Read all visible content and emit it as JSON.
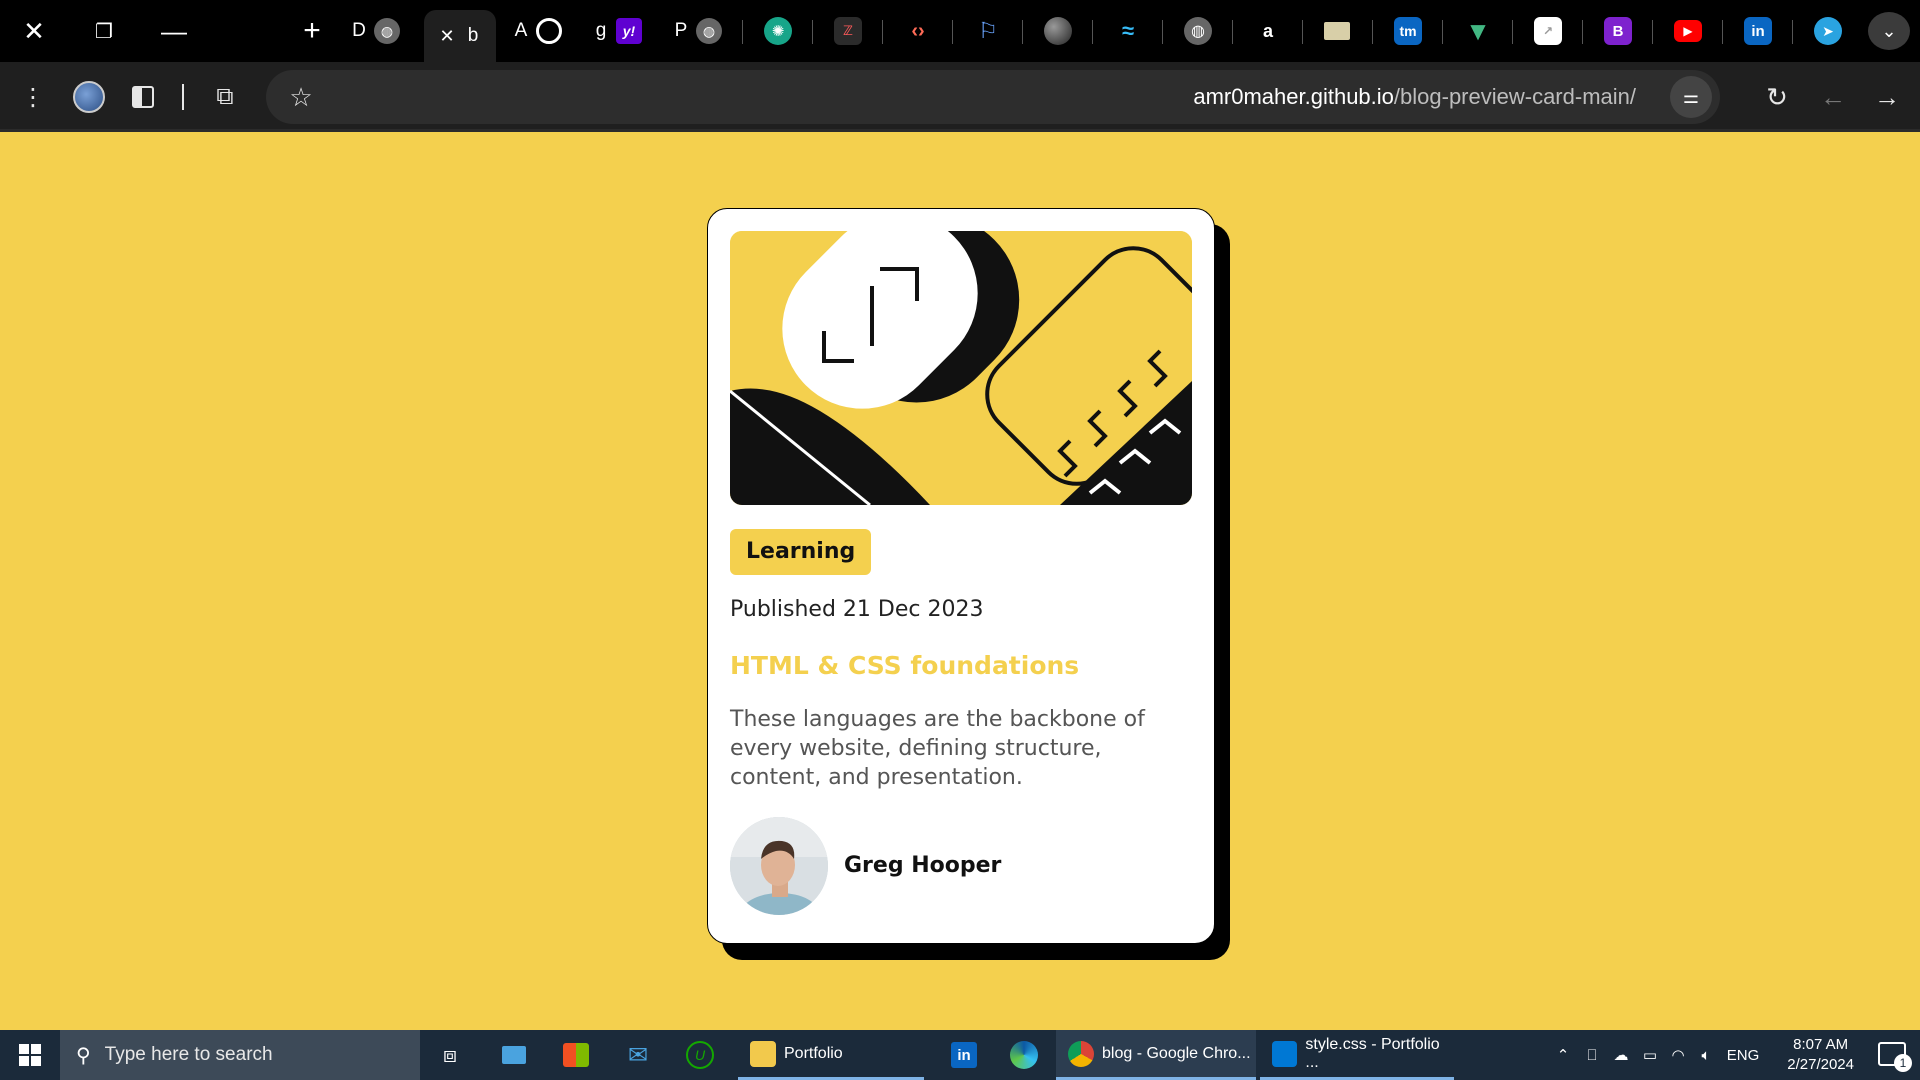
{
  "browser": {
    "tabs": [
      {
        "letter": "D",
        "icon": "globe-icon"
      },
      {
        "letter": "b",
        "icon": "close-icon",
        "active": true
      },
      {
        "letter": "A",
        "icon": "github-icon"
      },
      {
        "letter": "g",
        "icon": "yahoo-icon"
      },
      {
        "letter": "P",
        "icon": "globe-icon"
      }
    ],
    "pinned_icons": [
      "chatgpt-icon",
      "dev-icon",
      "code-icon",
      "flag-icon",
      "sphere-icon",
      "tailwind-icon",
      "globe-icon",
      "amazon-icon",
      "mail-icon",
      "tm-icon",
      "vue-icon",
      "doc-icon",
      "bootstrap-icon",
      "youtube-icon",
      "linkedin-icon",
      "telegram-icon"
    ],
    "pinned_labels": {
      "amazon": "a",
      "tm": "tm",
      "bootstrap": "B",
      "linkedin": "in",
      "yahoo": "y!"
    },
    "url_host": "amr0maher.github.io",
    "url_path": "/blog-preview-card-main/"
  },
  "card": {
    "badge": "Learning",
    "published": "Published 21 Dec 2023",
    "title": "HTML & CSS foundations",
    "description": "These languages are the backbone of every website, defining structure, content, and presentation.",
    "author": "Greg Hooper"
  },
  "colors": {
    "accent": "#F4D04E",
    "black": "#111111",
    "taskbar": "#1b2a3a"
  },
  "taskbar": {
    "search_placeholder": "Type here to search",
    "apps": [
      {
        "label": "Portfolio",
        "icon": "folder-icon"
      },
      {
        "label": "blog - Google Chro...",
        "icon": "chrome-icon",
        "active": true
      },
      {
        "label": "style.css - Portfolio ...",
        "icon": "vscode-icon"
      }
    ],
    "language": "ENG",
    "time": "8:07 AM",
    "date": "2/27/2024",
    "notifications": "1"
  }
}
